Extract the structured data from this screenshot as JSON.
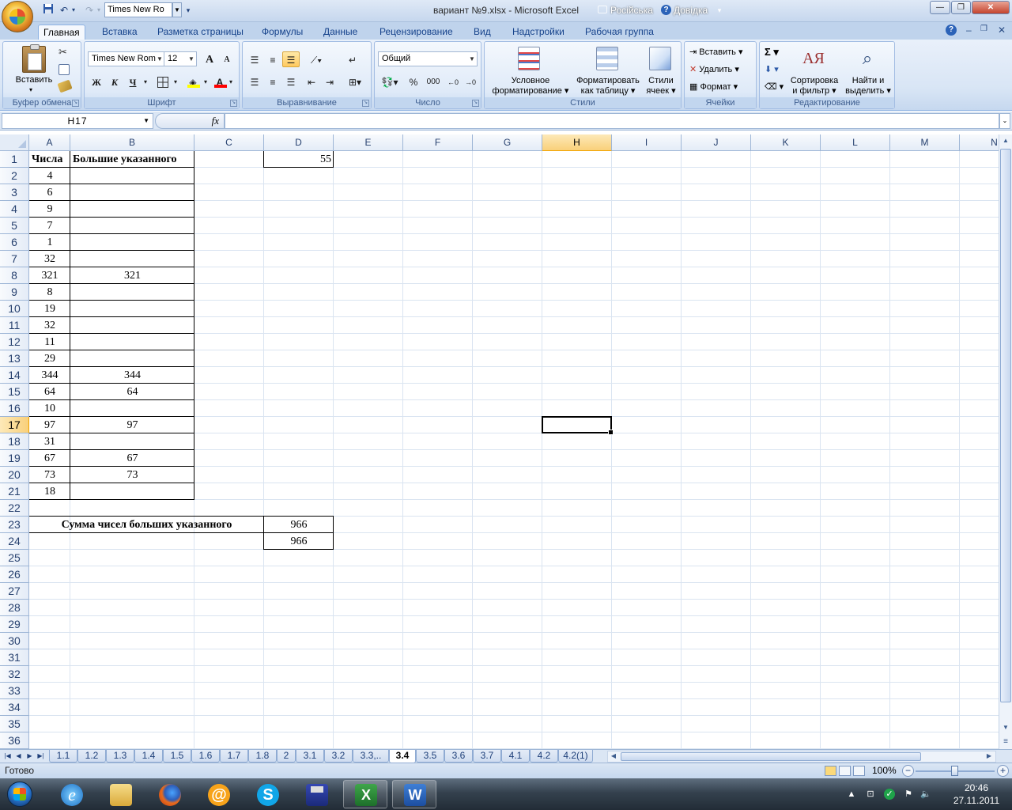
{
  "window": {
    "title": "вариант №9.xlsx - Microsoft Excel",
    "language": "Російська",
    "help": "Довідка",
    "qat_font": "Times New Ro"
  },
  "tabs": [
    "Главная",
    "Вставка",
    "Разметка страницы",
    "Формулы",
    "Данные",
    "Рецензирование",
    "Вид",
    "Надстройки",
    "Рабочая группа"
  ],
  "active_tab": "Главная",
  "ribbon": {
    "clipboard": {
      "label": "Буфер обмена",
      "paste": "Вставить"
    },
    "font": {
      "label": "Шрифт",
      "name": "Times New Rom",
      "size": "12",
      "bold": "Ж",
      "italic": "К",
      "underline": "Ч",
      "grow": "A",
      "shrink": "A",
      "fill_color": "#ffff00",
      "font_color": "#ff0000"
    },
    "alignment": {
      "label": "Выравнивание"
    },
    "number": {
      "label": "Число",
      "format": "Общий",
      "percent": "%",
      "thousands": "000"
    },
    "styles": {
      "label": "Стили",
      "conditional": [
        "Условное",
        "форматирование"
      ],
      "as_table": [
        "Форматировать",
        "как таблицу"
      ],
      "cell_styles": [
        "Стили",
        "ячеек"
      ]
    },
    "cells": {
      "label": "Ячейки",
      "insert": "Вставить",
      "delete": "Удалить",
      "format": "Формат"
    },
    "editing": {
      "label": "Редактирование",
      "sigma": "Σ",
      "sort": [
        "Сортировка",
        "и фильтр"
      ],
      "find": [
        "Найти и",
        "выделить"
      ]
    }
  },
  "formula_bar": {
    "name_box": "H17",
    "fx": "fx",
    "formula": ""
  },
  "columns": [
    "A",
    "B",
    "C",
    "D",
    "E",
    "F",
    "G",
    "H",
    "I",
    "J",
    "K",
    "L",
    "M",
    "N"
  ],
  "selected_column": "H",
  "selected_row": 17,
  "rows": [
    "1",
    "2",
    "3",
    "4",
    "5",
    "6",
    "7",
    "8",
    "9",
    "10",
    "11",
    "12",
    "13",
    "14",
    "15",
    "16",
    "17",
    "18",
    "19",
    "20",
    "21",
    "22",
    "23",
    "24",
    "25",
    "26",
    "27",
    "28",
    "29",
    "30",
    "31",
    "32",
    "33",
    "34",
    "35",
    "36"
  ],
  "cells": {
    "A1": "Числа",
    "B1": "Большие указанного",
    "D1": "55",
    "A2": "4",
    "A3": "6",
    "A4": "9",
    "A5": "7",
    "A6": "1",
    "A7": "32",
    "A8": "321",
    "B8": "321",
    "A9": "8",
    "A10": "19",
    "A11": "32",
    "A12": "11",
    "A13": "29",
    "A14": "344",
    "B14": "344",
    "A15": "64",
    "B15": "64",
    "A16": "10",
    "A17": "97",
    "B17": "97",
    "A18": "31",
    "A19": "67",
    "B19": "67",
    "A20": "73",
    "B20": "73",
    "A21": "18",
    "A23": "Сумма чисел больших указанного",
    "D23": "966",
    "D24": "966"
  },
  "sheet_tabs": [
    "1.1",
    "1.2",
    "1.3",
    "1.4",
    "1.5",
    "1.6",
    "1.7",
    "1.8",
    "2",
    "3.1",
    "3.2",
    "3.3,..",
    "3.4",
    "3.5",
    "3.6",
    "3.7",
    "4.1",
    "4.2",
    "4.2(1)"
  ],
  "active_sheet": "3.4",
  "status": {
    "text": "Готово",
    "zoom": "100%"
  },
  "taskbar": {
    "time": "20:46",
    "date": "27.11.2011"
  }
}
